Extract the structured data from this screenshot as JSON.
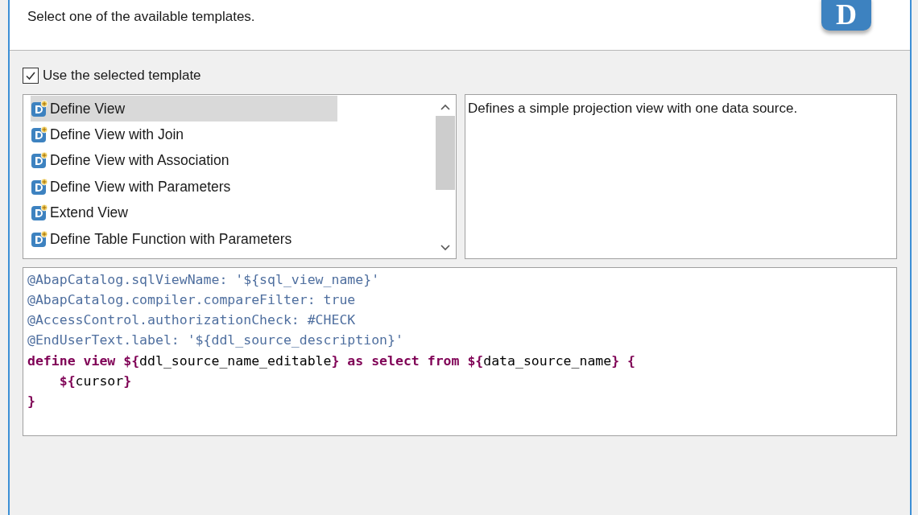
{
  "header": {
    "message": "Select one of the available templates.",
    "logo_letter": "D"
  },
  "use_template": {
    "label": "Use the selected template",
    "checked": true
  },
  "templates": [
    {
      "label": "Define View",
      "selected": true
    },
    {
      "label": "Define View with Join",
      "selected": false
    },
    {
      "label": "Define View with Association",
      "selected": false
    },
    {
      "label": "Define View with Parameters",
      "selected": false
    },
    {
      "label": "Extend View",
      "selected": false
    },
    {
      "label": "Define Table Function with Parameters",
      "selected": false
    }
  ],
  "description": "Defines a simple projection view with one data source.",
  "code_lines": [
    [
      {
        "text": "@AbapCatalog.sqlViewName: '${sql_view_name}'",
        "kind": "annotation"
      }
    ],
    [
      {
        "text": "@AbapCatalog.compiler.compareFilter: true",
        "kind": "annotation"
      }
    ],
    [
      {
        "text": "@AccessControl.authorizationCheck: #CHECK",
        "kind": "annotation"
      }
    ],
    [
      {
        "text": "@EndUserText.label: '${ddl_source_description}'",
        "kind": "annotation"
      }
    ],
    [
      {
        "text": "define view ${",
        "kind": "keyword"
      },
      {
        "text": "ddl_source_name_editable",
        "kind": "plain"
      },
      {
        "text": "} as select from ${",
        "kind": "keyword"
      },
      {
        "text": "data_source_name",
        "kind": "plain"
      },
      {
        "text": "} {",
        "kind": "keyword"
      }
    ],
    [
      {
        "text": "    ${",
        "kind": "keyword"
      },
      {
        "text": "cursor",
        "kind": "plain"
      },
      {
        "text": "}",
        "kind": "keyword"
      }
    ],
    [
      {
        "text": "}",
        "kind": "keyword"
      }
    ]
  ]
}
